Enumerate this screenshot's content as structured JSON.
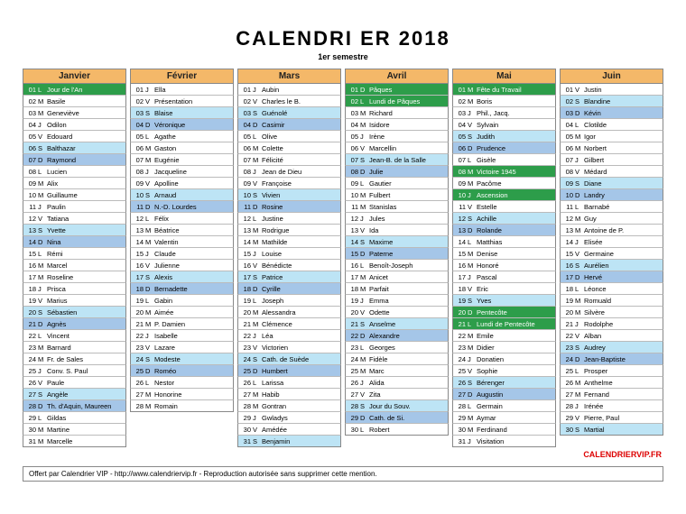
{
  "title": "CALENDRI ER 2018",
  "subtitle": "1er semestre",
  "brand": "CALENDRIERVIP.FR",
  "footer": "Offert par Calendrier VIP - http://www.calendriervip.fr - Reproduction autorisée sans supprimer cette mention.",
  "months": [
    {
      "name": "Janvier",
      "days": [
        {
          "d": "01",
          "w": "L",
          "t": "Jour de l'An",
          "c": "hl-green"
        },
        {
          "d": "02",
          "w": "M",
          "t": "Basile"
        },
        {
          "d": "03",
          "w": "M",
          "t": "Geneviève"
        },
        {
          "d": "04",
          "w": "J",
          "t": "Odilon"
        },
        {
          "d": "05",
          "w": "V",
          "t": "Edouard"
        },
        {
          "d": "06",
          "w": "S",
          "t": "Balthazar",
          "c": "hl-sky"
        },
        {
          "d": "07",
          "w": "D",
          "t": "Raymond",
          "c": "hl-lt-blue"
        },
        {
          "d": "08",
          "w": "L",
          "t": "Lucien"
        },
        {
          "d": "09",
          "w": "M",
          "t": "Alix"
        },
        {
          "d": "10",
          "w": "M",
          "t": "Guillaume"
        },
        {
          "d": "11",
          "w": "J",
          "t": "Paulin"
        },
        {
          "d": "12",
          "w": "V",
          "t": "Tatiana"
        },
        {
          "d": "13",
          "w": "S",
          "t": "Yvette",
          "c": "hl-sky"
        },
        {
          "d": "14",
          "w": "D",
          "t": "Nina",
          "c": "hl-lt-blue"
        },
        {
          "d": "15",
          "w": "L",
          "t": "Rémi"
        },
        {
          "d": "16",
          "w": "M",
          "t": "Marcel"
        },
        {
          "d": "17",
          "w": "M",
          "t": "Roseline"
        },
        {
          "d": "18",
          "w": "J",
          "t": "Prisca"
        },
        {
          "d": "19",
          "w": "V",
          "t": "Marius"
        },
        {
          "d": "20",
          "w": "S",
          "t": "Sébastien",
          "c": "hl-sky"
        },
        {
          "d": "21",
          "w": "D",
          "t": "Agnès",
          "c": "hl-lt-blue"
        },
        {
          "d": "22",
          "w": "L",
          "t": "Vincent"
        },
        {
          "d": "23",
          "w": "M",
          "t": "Barnard"
        },
        {
          "d": "24",
          "w": "M",
          "t": "Fr. de Sales"
        },
        {
          "d": "25",
          "w": "J",
          "t": "Conv. S. Paul"
        },
        {
          "d": "26",
          "w": "V",
          "t": "Paule"
        },
        {
          "d": "27",
          "w": "S",
          "t": "Angèle",
          "c": "hl-sky"
        },
        {
          "d": "28",
          "w": "D",
          "t": "Th. d'Aquin, Maureen",
          "c": "hl-lt-blue"
        },
        {
          "d": "29",
          "w": "L",
          "t": "Gildas"
        },
        {
          "d": "30",
          "w": "M",
          "t": "Martine"
        },
        {
          "d": "31",
          "w": "M",
          "t": "Marcelle"
        }
      ]
    },
    {
      "name": "Février",
      "days": [
        {
          "d": "01",
          "w": "J",
          "t": "Ella"
        },
        {
          "d": "02",
          "w": "V",
          "t": "Présentation"
        },
        {
          "d": "03",
          "w": "S",
          "t": "Blaise",
          "c": "hl-sky"
        },
        {
          "d": "04",
          "w": "D",
          "t": "Véronique",
          "c": "hl-lt-blue"
        },
        {
          "d": "05",
          "w": "L",
          "t": "Agathe"
        },
        {
          "d": "06",
          "w": "M",
          "t": "Gaston"
        },
        {
          "d": "07",
          "w": "M",
          "t": "Eugénie"
        },
        {
          "d": "08",
          "w": "J",
          "t": "Jacqueline"
        },
        {
          "d": "09",
          "w": "V",
          "t": "Apolline"
        },
        {
          "d": "10",
          "w": "S",
          "t": "Arnaud",
          "c": "hl-sky"
        },
        {
          "d": "11",
          "w": "D",
          "t": "N.-D. Lourdes",
          "c": "hl-lt-blue"
        },
        {
          "d": "12",
          "w": "L",
          "t": "Félix"
        },
        {
          "d": "13",
          "w": "M",
          "t": "Béatrice"
        },
        {
          "d": "14",
          "w": "M",
          "t": "Valentin"
        },
        {
          "d": "15",
          "w": "J",
          "t": "Claude"
        },
        {
          "d": "16",
          "w": "V",
          "t": "Julienne"
        },
        {
          "d": "17",
          "w": "S",
          "t": "Alexis",
          "c": "hl-sky"
        },
        {
          "d": "18",
          "w": "D",
          "t": "Bernadette",
          "c": "hl-lt-blue"
        },
        {
          "d": "19",
          "w": "L",
          "t": "Gabin"
        },
        {
          "d": "20",
          "w": "M",
          "t": "Aimée"
        },
        {
          "d": "21",
          "w": "M",
          "t": "P. Damien"
        },
        {
          "d": "22",
          "w": "J",
          "t": "Isabelle"
        },
        {
          "d": "23",
          "w": "V",
          "t": "Lazare"
        },
        {
          "d": "24",
          "w": "S",
          "t": "Modeste",
          "c": "hl-sky"
        },
        {
          "d": "25",
          "w": "D",
          "t": "Roméo",
          "c": "hl-lt-blue"
        },
        {
          "d": "26",
          "w": "L",
          "t": "Nestor"
        },
        {
          "d": "27",
          "w": "M",
          "t": "Honorine"
        },
        {
          "d": "28",
          "w": "M",
          "t": "Romain"
        }
      ]
    },
    {
      "name": "Mars",
      "days": [
        {
          "d": "01",
          "w": "J",
          "t": "Aubin"
        },
        {
          "d": "02",
          "w": "V",
          "t": "Charles le B."
        },
        {
          "d": "03",
          "w": "S",
          "t": "Guénolé",
          "c": "hl-sky"
        },
        {
          "d": "04",
          "w": "D",
          "t": "Casimir",
          "c": "hl-lt-blue"
        },
        {
          "d": "05",
          "w": "L",
          "t": "Olive"
        },
        {
          "d": "06",
          "w": "M",
          "t": "Colette"
        },
        {
          "d": "07",
          "w": "M",
          "t": "Félicité"
        },
        {
          "d": "08",
          "w": "J",
          "t": "Jean de Dieu"
        },
        {
          "d": "09",
          "w": "V",
          "t": "Françoise"
        },
        {
          "d": "10",
          "w": "S",
          "t": "Vivien",
          "c": "hl-sky"
        },
        {
          "d": "11",
          "w": "D",
          "t": "Rosine",
          "c": "hl-lt-blue"
        },
        {
          "d": "12",
          "w": "L",
          "t": "Justine"
        },
        {
          "d": "13",
          "w": "M",
          "t": "Rodrigue"
        },
        {
          "d": "14",
          "w": "M",
          "t": "Mathilde"
        },
        {
          "d": "15",
          "w": "J",
          "t": "Louise"
        },
        {
          "d": "16",
          "w": "V",
          "t": "Bénédicte"
        },
        {
          "d": "17",
          "w": "S",
          "t": "Patrice",
          "c": "hl-sky"
        },
        {
          "d": "18",
          "w": "D",
          "t": "Cyrille",
          "c": "hl-lt-blue"
        },
        {
          "d": "19",
          "w": "L",
          "t": "Joseph"
        },
        {
          "d": "20",
          "w": "M",
          "t": "Alessandra"
        },
        {
          "d": "21",
          "w": "M",
          "t": "Clémence"
        },
        {
          "d": "22",
          "w": "J",
          "t": "Léa"
        },
        {
          "d": "23",
          "w": "V",
          "t": "Victorien"
        },
        {
          "d": "24",
          "w": "S",
          "t": "Cath. de Suède",
          "c": "hl-sky"
        },
        {
          "d": "25",
          "w": "D",
          "t": "Humbert",
          "c": "hl-lt-blue"
        },
        {
          "d": "26",
          "w": "L",
          "t": "Larissa"
        },
        {
          "d": "27",
          "w": "M",
          "t": "Habib"
        },
        {
          "d": "28",
          "w": "M",
          "t": "Gontran"
        },
        {
          "d": "29",
          "w": "J",
          "t": "Gwladys"
        },
        {
          "d": "30",
          "w": "V",
          "t": "Amédée"
        },
        {
          "d": "31",
          "w": "S",
          "t": "Benjamin",
          "c": "hl-sky"
        }
      ]
    },
    {
      "name": "Avril",
      "days": [
        {
          "d": "01",
          "w": "D",
          "t": "Pâques",
          "c": "hl-green"
        },
        {
          "d": "02",
          "w": "L",
          "t": "Lundi de Pâques",
          "c": "hl-green"
        },
        {
          "d": "03",
          "w": "M",
          "t": "Richard"
        },
        {
          "d": "04",
          "w": "M",
          "t": "Isidore"
        },
        {
          "d": "05",
          "w": "J",
          "t": "Irène"
        },
        {
          "d": "06",
          "w": "V",
          "t": "Marcellin"
        },
        {
          "d": "07",
          "w": "S",
          "t": "Jean-B. de la Salle",
          "c": "hl-sky"
        },
        {
          "d": "08",
          "w": "D",
          "t": "Julie",
          "c": "hl-lt-blue"
        },
        {
          "d": "09",
          "w": "L",
          "t": "Gautier"
        },
        {
          "d": "10",
          "w": "M",
          "t": "Fulbert"
        },
        {
          "d": "11",
          "w": "M",
          "t": "Stanislas"
        },
        {
          "d": "12",
          "w": "J",
          "t": "Jules"
        },
        {
          "d": "13",
          "w": "V",
          "t": "Ida"
        },
        {
          "d": "14",
          "w": "S",
          "t": "Maxime",
          "c": "hl-sky"
        },
        {
          "d": "15",
          "w": "D",
          "t": "Paterne",
          "c": "hl-lt-blue"
        },
        {
          "d": "16",
          "w": "L",
          "t": "Benoît-Joseph"
        },
        {
          "d": "17",
          "w": "M",
          "t": "Anicet"
        },
        {
          "d": "18",
          "w": "M",
          "t": "Parfait"
        },
        {
          "d": "19",
          "w": "J",
          "t": "Emma"
        },
        {
          "d": "20",
          "w": "V",
          "t": "Odette"
        },
        {
          "d": "21",
          "w": "S",
          "t": "Anselme",
          "c": "hl-sky"
        },
        {
          "d": "22",
          "w": "D",
          "t": "Alexandre",
          "c": "hl-lt-blue"
        },
        {
          "d": "23",
          "w": "L",
          "t": "Georges"
        },
        {
          "d": "24",
          "w": "M",
          "t": "Fidèle"
        },
        {
          "d": "25",
          "w": "M",
          "t": "Marc"
        },
        {
          "d": "26",
          "w": "J",
          "t": "Alida"
        },
        {
          "d": "27",
          "w": "V",
          "t": "Zita"
        },
        {
          "d": "28",
          "w": "S",
          "t": "Jour du Souv.",
          "c": "hl-sky"
        },
        {
          "d": "29",
          "w": "D",
          "t": "Cath. de Si.",
          "c": "hl-lt-blue"
        },
        {
          "d": "30",
          "w": "L",
          "t": "Robert"
        }
      ]
    },
    {
      "name": "Mai",
      "days": [
        {
          "d": "01",
          "w": "M",
          "t": "Fête du Travail",
          "c": "hl-green"
        },
        {
          "d": "02",
          "w": "M",
          "t": "Boris"
        },
        {
          "d": "03",
          "w": "J",
          "t": "Phil., Jacq."
        },
        {
          "d": "04",
          "w": "V",
          "t": "Sylvain"
        },
        {
          "d": "05",
          "w": "S",
          "t": "Judith",
          "c": "hl-sky"
        },
        {
          "d": "06",
          "w": "D",
          "t": "Prudence",
          "c": "hl-lt-blue"
        },
        {
          "d": "07",
          "w": "L",
          "t": "Gisèle"
        },
        {
          "d": "08",
          "w": "M",
          "t": "Victoire 1945",
          "c": "hl-green"
        },
        {
          "d": "09",
          "w": "M",
          "t": "Pacôme"
        },
        {
          "d": "10",
          "w": "J",
          "t": "Ascension",
          "c": "hl-green"
        },
        {
          "d": "11",
          "w": "V",
          "t": "Estelle"
        },
        {
          "d": "12",
          "w": "S",
          "t": "Achille",
          "c": "hl-sky"
        },
        {
          "d": "13",
          "w": "D",
          "t": "Rolande",
          "c": "hl-lt-blue"
        },
        {
          "d": "14",
          "w": "L",
          "t": "Matthias"
        },
        {
          "d": "15",
          "w": "M",
          "t": "Denise"
        },
        {
          "d": "16",
          "w": "M",
          "t": "Honoré"
        },
        {
          "d": "17",
          "w": "J",
          "t": "Pascal"
        },
        {
          "d": "18",
          "w": "V",
          "t": "Eric"
        },
        {
          "d": "19",
          "w": "S",
          "t": "Yves",
          "c": "hl-sky"
        },
        {
          "d": "20",
          "w": "D",
          "t": "Pentecôte",
          "c": "hl-green"
        },
        {
          "d": "21",
          "w": "L",
          "t": "Lundi de Pentecôte",
          "c": "hl-green"
        },
        {
          "d": "22",
          "w": "M",
          "t": "Emile"
        },
        {
          "d": "23",
          "w": "M",
          "t": "Didier"
        },
        {
          "d": "24",
          "w": "J",
          "t": "Donatien"
        },
        {
          "d": "25",
          "w": "V",
          "t": "Sophie"
        },
        {
          "d": "26",
          "w": "S",
          "t": "Bérenger",
          "c": "hl-sky"
        },
        {
          "d": "27",
          "w": "D",
          "t": "Augustin",
          "c": "hl-lt-blue"
        },
        {
          "d": "28",
          "w": "L",
          "t": "Germain"
        },
        {
          "d": "29",
          "w": "M",
          "t": "Aymar"
        },
        {
          "d": "30",
          "w": "M",
          "t": "Ferdinand"
        },
        {
          "d": "31",
          "w": "J",
          "t": "Visitation"
        }
      ]
    },
    {
      "name": "Juin",
      "days": [
        {
          "d": "01",
          "w": "V",
          "t": "Justin"
        },
        {
          "d": "02",
          "w": "S",
          "t": "Blandine",
          "c": "hl-sky"
        },
        {
          "d": "03",
          "w": "D",
          "t": "Kévin",
          "c": "hl-lt-blue"
        },
        {
          "d": "04",
          "w": "L",
          "t": "Clotilde"
        },
        {
          "d": "05",
          "w": "M",
          "t": "Igor"
        },
        {
          "d": "06",
          "w": "M",
          "t": "Norbert"
        },
        {
          "d": "07",
          "w": "J",
          "t": "Gilbert"
        },
        {
          "d": "08",
          "w": "V",
          "t": "Médard"
        },
        {
          "d": "09",
          "w": "S",
          "t": "Diane",
          "c": "hl-sky"
        },
        {
          "d": "10",
          "w": "D",
          "t": "Landry",
          "c": "hl-lt-blue"
        },
        {
          "d": "11",
          "w": "L",
          "t": "Barnabé"
        },
        {
          "d": "12",
          "w": "M",
          "t": "Guy"
        },
        {
          "d": "13",
          "w": "M",
          "t": "Antoine de P."
        },
        {
          "d": "14",
          "w": "J",
          "t": "Elisée"
        },
        {
          "d": "15",
          "w": "V",
          "t": "Germaine"
        },
        {
          "d": "16",
          "w": "S",
          "t": "Aurélien",
          "c": "hl-sky"
        },
        {
          "d": "17",
          "w": "D",
          "t": "Hervé",
          "c": "hl-lt-blue"
        },
        {
          "d": "18",
          "w": "L",
          "t": "Léonce"
        },
        {
          "d": "19",
          "w": "M",
          "t": "Romuald"
        },
        {
          "d": "20",
          "w": "M",
          "t": "Silvère"
        },
        {
          "d": "21",
          "w": "J",
          "t": "Rodolphe"
        },
        {
          "d": "22",
          "w": "V",
          "t": "Alban"
        },
        {
          "d": "23",
          "w": "S",
          "t": "Audrey",
          "c": "hl-sky"
        },
        {
          "d": "24",
          "w": "D",
          "t": "Jean-Baptiste",
          "c": "hl-lt-blue"
        },
        {
          "d": "25",
          "w": "L",
          "t": "Prosper"
        },
        {
          "d": "26",
          "w": "M",
          "t": "Anthelme"
        },
        {
          "d": "27",
          "w": "M",
          "t": "Fernand"
        },
        {
          "d": "28",
          "w": "J",
          "t": "Irénée"
        },
        {
          "d": "29",
          "w": "V",
          "t": "Pierre, Paul"
        },
        {
          "d": "30",
          "w": "S",
          "t": "Martial",
          "c": "hl-sky"
        }
      ]
    }
  ]
}
